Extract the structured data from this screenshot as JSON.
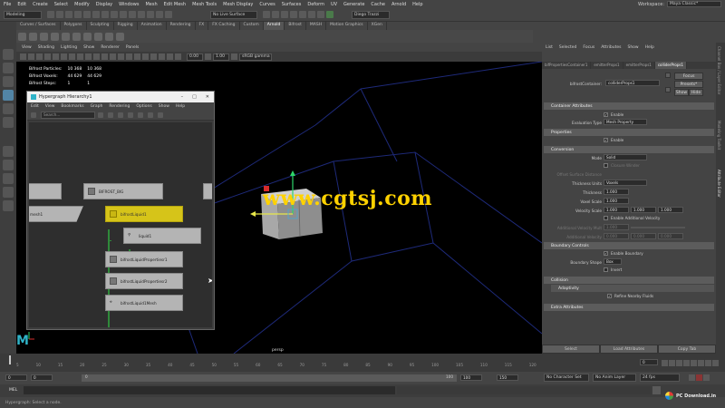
{
  "menubar": {
    "items": [
      "File",
      "Edit",
      "Create",
      "Select",
      "Modify",
      "Display",
      "Windows",
      "Mesh",
      "Edit Mesh",
      "Mesh Tools",
      "Mesh Display",
      "Curves",
      "Surfaces",
      "Deform",
      "UV",
      "Generate",
      "Cache",
      "Arnold",
      "Help"
    ],
    "workspace_label": "Workspace:",
    "workspace_value": "Maya Classic*"
  },
  "statusline": {
    "mode": "Modeling",
    "live_surface": "No Live Surface",
    "user": "Diego Trazzi"
  },
  "shelf": {
    "tabs": [
      "Curves / Surfaces",
      "Polygons",
      "Sculpting",
      "Rigging",
      "Animation",
      "Rendering",
      "FX",
      "FX Caching",
      "Custom",
      "Arnold",
      "Bifrost",
      "MASH",
      "Motion Graphics",
      "XGen"
    ],
    "active_tab": "Arnold"
  },
  "viewport": {
    "menu": [
      "View",
      "Shading",
      "Lighting",
      "Show",
      "Renderer",
      "Panels"
    ],
    "field_value": "0.00",
    "field_value2": "1.00",
    "color_space": "sRGB gamma",
    "hud": [
      {
        "label": "Bifrost Particles:",
        "v1": "10 368",
        "v2": "10 368"
      },
      {
        "label": "Bifrost Voxels:",
        "v1": "44 629",
        "v2": "44 629"
      },
      {
        "label": "Bifrost Steps:",
        "v1": "1",
        "v2": "1"
      }
    ],
    "camera": "persp",
    "watermark": "www.cgtsj.com"
  },
  "hypergraph": {
    "title": "Hypergraph Hierarchy1",
    "menu": [
      "Edit",
      "View",
      "Bookmarks",
      "Graph",
      "Rendering",
      "Options",
      "Show",
      "Help"
    ],
    "search_placeholder": "Search...",
    "nodes": {
      "bifrost_big": "BIFROST_BIG",
      "mesh": "mesh1",
      "liquid": "bifrostLiquid1",
      "liquid_child": "liquid1",
      "props1": "bifrostLiquidPropertiesr1",
      "props2": "bifrostLiquidPropertiesr2",
      "liquid_mesh": "bifrostLiquid1Mesh"
    }
  },
  "attribute_editor": {
    "menu": [
      "List",
      "Selected",
      "Focus",
      "Attributes",
      "Show",
      "Help"
    ],
    "tabs": [
      "bifPropertiesContainer1",
      "emitterProps1",
      "emitterProps1",
      "colliderProps1"
    ],
    "active_tab": "colliderProps1",
    "container_label": "bifrostContainer:",
    "container_value": "colliderProps1",
    "focus_btn": "Focus",
    "presets_btn": "Presets*",
    "show_btn": "Show",
    "hide_btn": "Hide",
    "sections": {
      "container_attrs": "Container Attributes",
      "properties": "Properties",
      "conversion": "Conversion",
      "boundary": "Boundary Controls",
      "collision": "Collision",
      "adaptivity": "Adaptivity",
      "extra": "Extra Attributes"
    },
    "enable": "Enable",
    "eval_type_label": "Evaluation Type",
    "eval_type_value": "Mesh Property",
    "enable2": "Enable",
    "mode_label": "Mode",
    "mode_value": "Solid",
    "closure_label": "Closure Winder",
    "offset_label": "Offset Surface Distance",
    "thickness_units_label": "Thickness Units",
    "thickness_units_value": "Voxels",
    "thickness_label": "Thickness",
    "thickness_value": "1.000",
    "voxel_scale_label": "Voxel Scale",
    "voxel_scale_value": "1.000",
    "velocity_scale_label": "Velocity Scale",
    "velocity_scale_values": [
      "1.000",
      "1.000",
      "1.000"
    ],
    "enable_add_vel": "Enable Additional Velocity",
    "add_vel_mult_label": "Additional Velocity Mult",
    "add_vel_mult_value": "1.000",
    "add_vel_label": "Additional Velocity",
    "add_vel_values": [
      "0.000",
      "0.000",
      "0.000"
    ],
    "enable_boundary": "Enable Boundary",
    "boundary_shape_label": "Boundary Shape",
    "boundary_shape_value": "Box",
    "invert": "Invert",
    "refine_nearby": "Refine Nearby Fluids",
    "footer": [
      "Select",
      "Load Attributes",
      "Copy Tab"
    ],
    "side_tabs": [
      "Channel Box / Layer Editor",
      "Modeling Toolkit",
      "Attribute Editor"
    ]
  },
  "timeline": {
    "ticks": [
      "5",
      "10",
      "15",
      "20",
      "25",
      "30",
      "35",
      "40",
      "45",
      "50",
      "55",
      "60",
      "65",
      "70",
      "75",
      "80",
      "85",
      "90",
      "95",
      "100",
      "105",
      "110",
      "115",
      "120"
    ],
    "current_frame": "0",
    "range_start": "0",
    "range_inner_start": "0",
    "range_inner_end": "100",
    "range_end": "150",
    "anim_end": "150",
    "character_set": "No Character Set",
    "anim_layer": "No Anim Layer",
    "fps": "24 fps"
  },
  "cmdline": {
    "label": "MEL"
  },
  "helpline": {
    "text": "Hypergraph: Select a node.",
    "logo_text": "PC Download.in"
  }
}
